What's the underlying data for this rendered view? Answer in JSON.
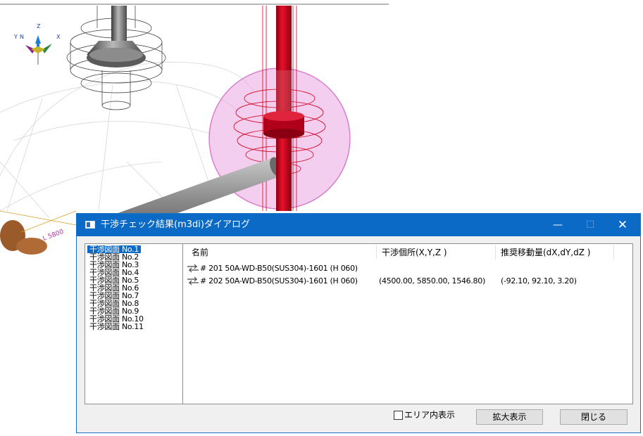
{
  "viewport": {
    "axis_labels": {
      "y": "Y",
      "n": "N",
      "z": "Z",
      "x": "X"
    },
    "dimension_label": "L 5800"
  },
  "dialog": {
    "title": "干渉チェック結果(m3di)ダイアログ",
    "controls": {
      "minimize": "—",
      "maximize": "☐",
      "close": "✕"
    },
    "drawings": [
      "干渉図面 No.1",
      "干渉図面 No.2",
      "干渉図面 No.3",
      "干渉図面 No.4",
      "干渉図面 No.5",
      "干渉図面 No.6",
      "干渉図面 No.7",
      "干渉図面 No.8",
      "干渉図面 No.9",
      "干渉図面 No.10",
      "干渉図面 No.11"
    ],
    "selected_drawing": "干渉図面 No.1",
    "columns": [
      "名前",
      "干渉個所(X,Y,Z )",
      "推奨移動量(dX,dY,dZ )"
    ],
    "rows": [
      {
        "name": "# 201 50A-WD-B50(SUS304)-1601 (H 060)",
        "location": "",
        "move": ""
      },
      {
        "name": "# 202 50A-WD-B50(SUS304)-1601 (H 060)",
        "location": "(4500.00, 5850.00, 1546.80)",
        "move": "(-92.10, 92.10, 3.20)"
      }
    ],
    "area_checkbox_label": "エリア内表示",
    "area_checked": false,
    "zoom_button": "拡大表示",
    "close_button": "閉じる"
  }
}
